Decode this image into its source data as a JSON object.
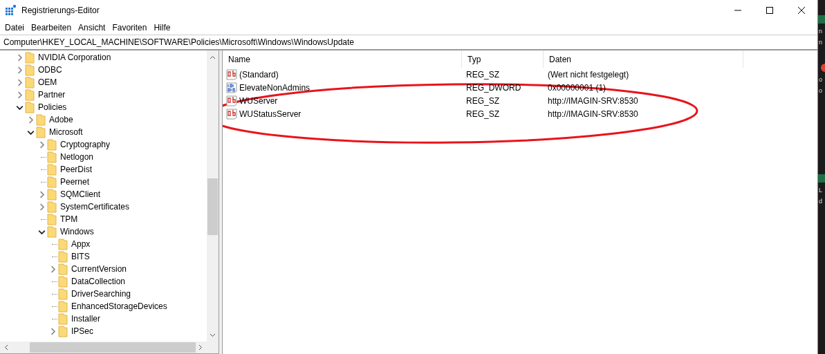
{
  "window": {
    "title": "Registrierungs-Editor"
  },
  "menu": [
    "Datei",
    "Bearbeiten",
    "Ansicht",
    "Favoriten",
    "Hilfe"
  ],
  "address": "Computer\\HKEY_LOCAL_MACHINE\\SOFTWARE\\Policies\\Microsoft\\Windows\\WindowsUpdate",
  "tree": [
    {
      "label": "NVIDIA Corporation",
      "expandable": true,
      "expanded": false
    },
    {
      "label": "ODBC",
      "expandable": true,
      "expanded": false
    },
    {
      "label": "OEM",
      "expandable": true,
      "expanded": false
    },
    {
      "label": "Partner",
      "expandable": true,
      "expanded": false
    },
    {
      "label": "Policies",
      "expandable": true,
      "expanded": true,
      "children": [
        {
          "label": "Adobe",
          "expandable": true,
          "expanded": false
        },
        {
          "label": "Microsoft",
          "expandable": true,
          "expanded": true,
          "children": [
            {
              "label": "Cryptography",
              "expandable": true,
              "expanded": false
            },
            {
              "label": "Netlogon",
              "expandable": false,
              "expanded": false
            },
            {
              "label": "PeerDist",
              "expandable": false,
              "expanded": false
            },
            {
              "label": "Peernet",
              "expandable": false,
              "expanded": false
            },
            {
              "label": "SQMClient",
              "expandable": true,
              "expanded": false
            },
            {
              "label": "SystemCertificates",
              "expandable": true,
              "expanded": false
            },
            {
              "label": "TPM",
              "expandable": false,
              "expanded": false
            },
            {
              "label": "Windows",
              "expandable": true,
              "expanded": true,
              "children": [
                {
                  "label": "Appx",
                  "expandable": false,
                  "expanded": false
                },
                {
                  "label": "BITS",
                  "expandable": false,
                  "expanded": false
                },
                {
                  "label": "CurrentVersion",
                  "expandable": true,
                  "expanded": false
                },
                {
                  "label": "DataCollection",
                  "expandable": false,
                  "expanded": false
                },
                {
                  "label": "DriverSearching",
                  "expandable": false,
                  "expanded": false
                },
                {
                  "label": "EnhancedStorageDevices",
                  "expandable": false,
                  "expanded": false
                },
                {
                  "label": "Installer",
                  "expandable": false,
                  "expanded": false
                },
                {
                  "label": "IPSec",
                  "expandable": true,
                  "expanded": false
                }
              ]
            }
          ]
        }
      ]
    }
  ],
  "table": {
    "columns": [
      "Name",
      "Typ",
      "Daten"
    ],
    "rows": [
      {
        "kind": "string",
        "name": "(Standard)",
        "type": "REG_SZ",
        "data": "(Wert nicht festgelegt)"
      },
      {
        "kind": "binary",
        "name": "ElevateNonAdmins",
        "type": "REG_DWORD",
        "data": "0x00000001 (1)"
      },
      {
        "kind": "string",
        "name": "WUServer",
        "type": "REG_SZ",
        "data": "http://IMAGIN-SRV:8530"
      },
      {
        "kind": "string",
        "name": "WUStatusServer",
        "type": "REG_SZ",
        "data": "http://IMAGIN-SRV:8530"
      }
    ]
  },
  "desktop_fragments": [
    "n",
    "n",
    "o",
    "o",
    "L",
    "d"
  ]
}
